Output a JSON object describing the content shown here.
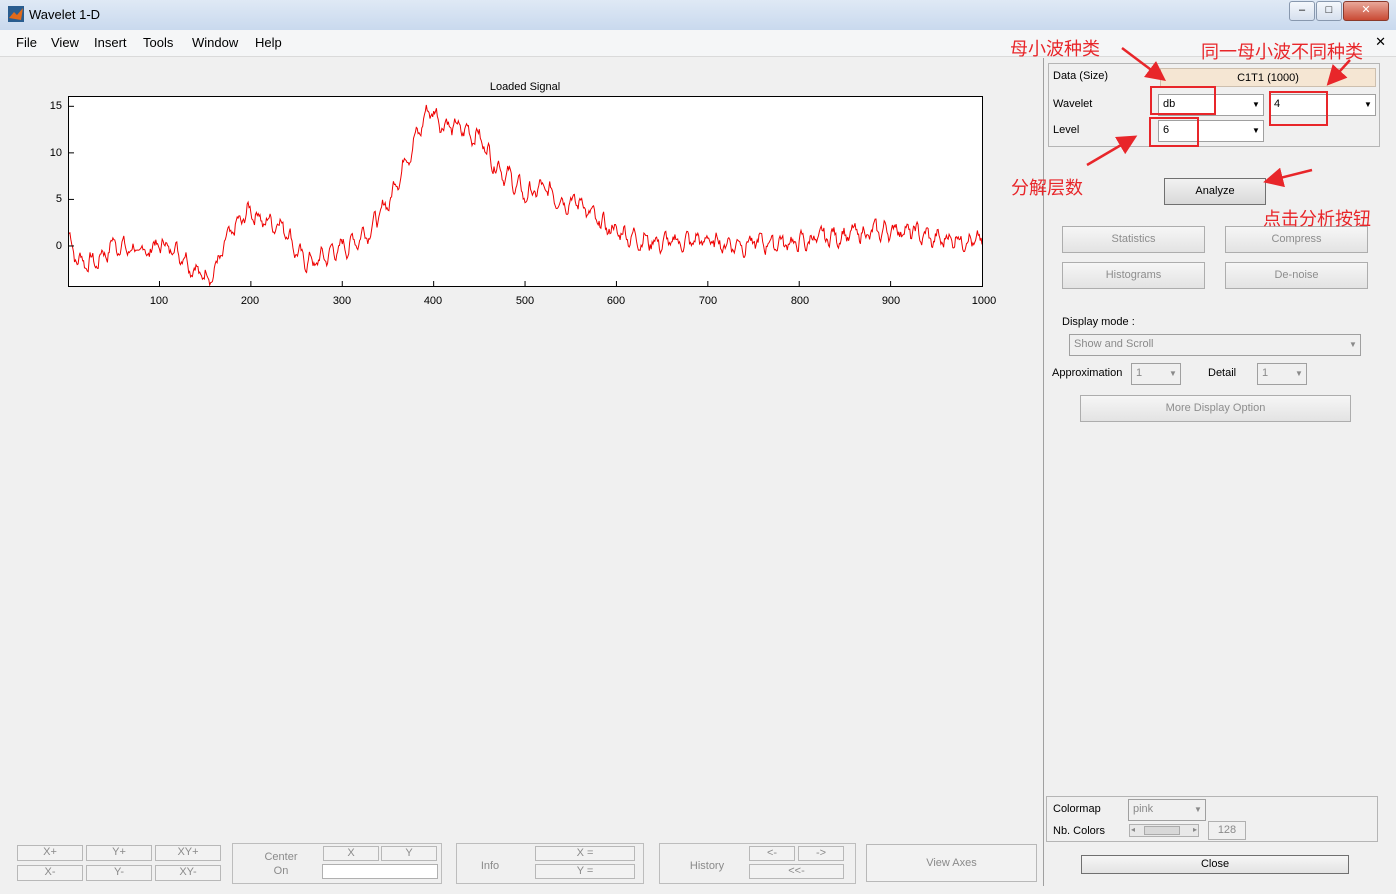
{
  "window": {
    "title": "Wavelet 1-D",
    "min_label": "–",
    "max_label": "□",
    "close_label": "✕"
  },
  "menu": [
    "File",
    "View",
    "Insert",
    "Tools",
    "Window",
    "Help"
  ],
  "menu_close": "✕",
  "plot": {
    "title": "Loaded Signal",
    "y_ticks": [
      "15",
      "10",
      "5",
      "0"
    ],
    "x_ticks": [
      "100",
      "200",
      "300",
      "400",
      "500",
      "600",
      "700",
      "800",
      "900",
      "1000"
    ]
  },
  "chart_data": {
    "type": "line",
    "title": "Loaded Signal",
    "xlim": [
      1,
      1000
    ],
    "ylim": [
      -4.3,
      16
    ],
    "line_color": "#ee0000",
    "x": [
      1,
      10,
      30,
      50,
      80,
      100,
      120,
      140,
      150,
      160,
      175,
      190,
      200,
      215,
      235,
      255,
      270,
      290,
      310,
      330,
      350,
      370,
      385,
      395,
      410,
      430,
      450,
      465,
      485,
      500,
      520,
      540,
      560,
      580,
      600,
      620,
      650,
      680,
      700,
      720,
      750,
      780,
      800,
      820,
      850,
      880,
      910,
      930,
      950,
      970,
      990,
      1000
    ],
    "y": [
      1,
      -1.5,
      -1.8,
      0.3,
      -0.8,
      0.2,
      -0.4,
      -2.6,
      -3.2,
      -2.8,
      0.8,
      2.8,
      3.9,
      2.6,
      2.4,
      -1.4,
      -1.8,
      -0.6,
      0.3,
      1.8,
      4.6,
      9.5,
      12.5,
      14.8,
      13.2,
      12.5,
      11.8,
      9.1,
      7.1,
      5.4,
      6.2,
      4.9,
      4.8,
      2.4,
      1.6,
      0.9,
      0.3,
      0.5,
      0.6,
      0.2,
      0.3,
      0.4,
      0.3,
      0.8,
      1.2,
      1.4,
      1.9,
      1.3,
      0.6,
      0.9,
      0.6,
      0.1
    ]
  },
  "panel": {
    "data_label": "Data  (Size)",
    "data_value": "C1T1  (1000)",
    "wavelet_label": "Wavelet",
    "wavelet_family": "db",
    "wavelet_order": "4",
    "level_label": "Level",
    "level_value": "6",
    "analyze": "Analyze",
    "statistics": "Statistics",
    "compress": "Compress",
    "histograms": "Histograms",
    "denoise": "De-noise",
    "display_mode_label": "Display mode :",
    "display_mode_value": "Show and Scroll",
    "approx_label": "Approximation",
    "approx_value": "1",
    "detail_label": "Detail",
    "detail_value": "1",
    "more_display": "More Display Option",
    "colormap_label": "Colormap",
    "colormap_value": "pink",
    "nbcolors_label": "Nb. Colors",
    "nbcolors_value": "128",
    "close": "Close"
  },
  "annotations": {
    "family": "母小波种类",
    "order": "同一母小波不同种类",
    "level": "分解层数",
    "analyze": "点击分析按钮",
    "color": "#e8262a"
  },
  "toolbar": {
    "xplus": "X+",
    "yplus": "Y+",
    "xyplus": "XY+",
    "xminus": "X-",
    "yminus": "Y-",
    "xyminus": "XY-",
    "center": "Center",
    "on": "On",
    "cx": "X",
    "cy": "Y",
    "info": "Info",
    "xeq": "X =",
    "yeq": "Y =",
    "history": "History",
    "back": "<-",
    "fwd": "->",
    "first": "<<-",
    "view_axes": "View Axes"
  }
}
